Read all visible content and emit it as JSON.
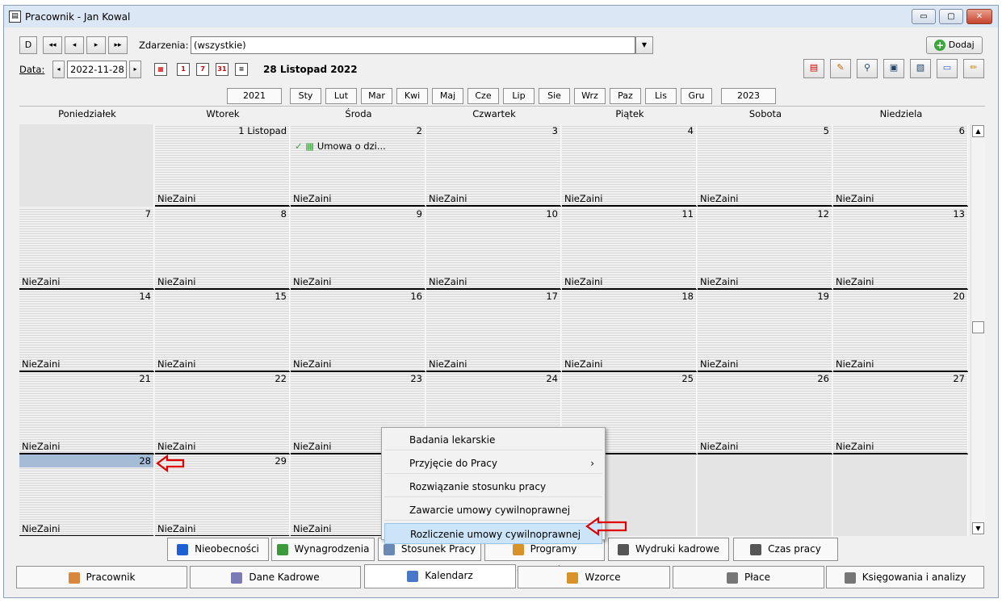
{
  "window": {
    "title": "Pracownik - Jan Kowal",
    "min": "▭",
    "max": "▢",
    "close": "✕"
  },
  "toolbar": {
    "nav_buttons": [
      "D",
      "◂◂",
      "◂",
      "▸",
      "▸▸"
    ],
    "events_label": "Zdarzenia:",
    "events_value": "(wszystkie)",
    "add_label": "Dodaj",
    "date_label": "Data:",
    "date_value": "2022-11-28",
    "date_long": "28 Listopad 2022"
  },
  "years": {
    "prev": "2021",
    "next": "2023"
  },
  "months": [
    "Sty",
    "Lut",
    "Mar",
    "Kwi",
    "Maj",
    "Cze",
    "Lip",
    "Sie",
    "Wrz",
    "Paz",
    "Lis",
    "Gru"
  ],
  "days": [
    "Poniedziałek",
    "Wtorek",
    "Środa",
    "Czwartek",
    "Piątek",
    "Sobota",
    "Niedziela"
  ],
  "weeks": [
    [
      {
        "d": ""
      },
      {
        "d": "1 Listopad",
        "s": "NieZaini"
      },
      {
        "d": "2",
        "s": "NieZaini",
        "e": "Umowa o dzi..."
      },
      {
        "d": "3",
        "s": "NieZaini"
      },
      {
        "d": "4",
        "s": "NieZaini"
      },
      {
        "d": "5",
        "s": "NieZaini"
      },
      {
        "d": "6",
        "s": "NieZaini"
      }
    ],
    [
      {
        "d": "7",
        "s": "NieZaini"
      },
      {
        "d": "8",
        "s": "NieZaini"
      },
      {
        "d": "9",
        "s": "NieZaini"
      },
      {
        "d": "10",
        "s": "NieZaini"
      },
      {
        "d": "11",
        "s": "NieZaini"
      },
      {
        "d": "12",
        "s": "NieZaini"
      },
      {
        "d": "13",
        "s": "NieZaini"
      }
    ],
    [
      {
        "d": "14",
        "s": "NieZaini"
      },
      {
        "d": "15",
        "s": "NieZaini"
      },
      {
        "d": "16",
        "s": "NieZaini"
      },
      {
        "d": "17",
        "s": "NieZaini"
      },
      {
        "d": "18",
        "s": "NieZaini"
      },
      {
        "d": "19",
        "s": "NieZaini"
      },
      {
        "d": "20",
        "s": "NieZaini"
      }
    ],
    [
      {
        "d": "21",
        "s": "NieZaini"
      },
      {
        "d": "22",
        "s": "NieZaini"
      },
      {
        "d": "23",
        "s": "NieZaini"
      },
      {
        "d": "24",
        "s": ""
      },
      {
        "d": "25",
        "s": ""
      },
      {
        "d": "26",
        "s": "NieZaini"
      },
      {
        "d": "27",
        "s": "NieZaini"
      }
    ],
    [
      {
        "d": "28",
        "s": "NieZaini",
        "today": true
      },
      {
        "d": "29",
        "s": "NieZaini"
      },
      {
        "d": "",
        "s": "NieZaini"
      },
      {
        "d": ""
      },
      {
        "d": ""
      },
      {
        "d": ""
      },
      {
        "d": ""
      }
    ]
  ],
  "context_menu": [
    {
      "label": "Badania lekarskie"
    },
    {
      "label": "Przyjęcie do Pracy",
      "submenu": "›"
    },
    {
      "label": "Rozwiązanie stosunku pracy"
    },
    {
      "label": "Zawarcie umowy cywilnoprawnej"
    },
    {
      "label": "Rozliczenie umowy cywilnoprawnej",
      "selected": true
    }
  ],
  "subtabs": [
    "Nieobecności",
    "Wynagrodzenia",
    "Stosunek Pracy",
    "Programy emerytalne",
    "Wydruki kadrowe",
    "Czas pracy"
  ],
  "maintabs": [
    "Pracownik",
    "Dane Kadrowe",
    "Kalendarz",
    "Wzorce",
    "Płace",
    "Księgowania i analizy"
  ],
  "accent_color": "#a4bcd6",
  "arrow_color": "#e00000"
}
